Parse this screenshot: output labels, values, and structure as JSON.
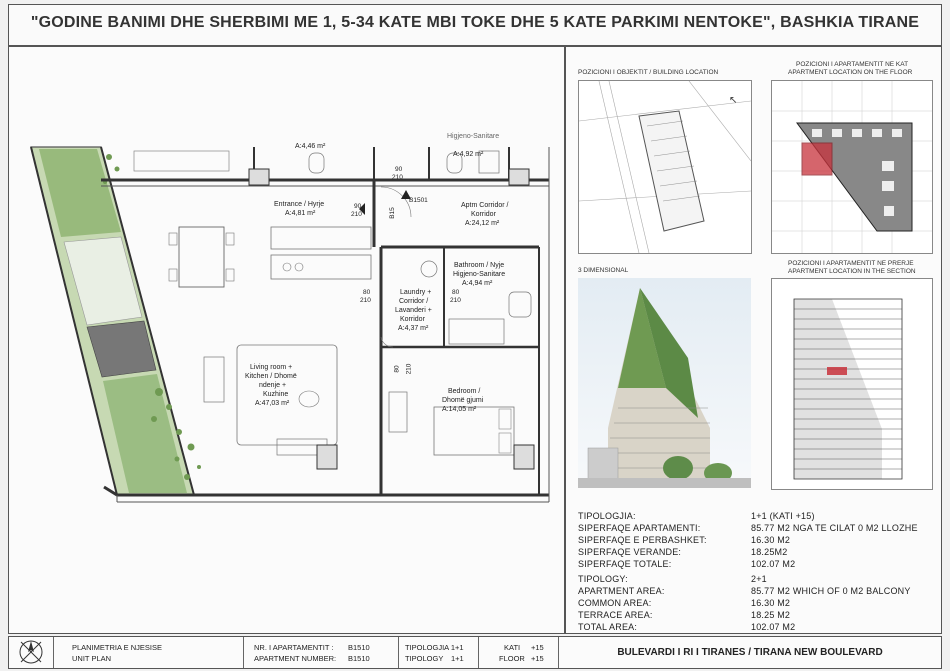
{
  "title": "\"GODINE BANIMI DHE SHERBIMI ME 1, 5-34 KATE MBI TOKE DHE 5 KATE PARKIMI NENTOKE\", BASHKIA TIRANE",
  "captions": {
    "building_location": "POZICIONI I OBJEKTIT / BUILDING LOCATION",
    "apt_floor_1": "POZICIONI I APARTAMENTIT NE KAT",
    "apt_floor_2": "APARTMENT LOCATION ON THE FLOOR",
    "three_d": "3 DIMENSIONAL",
    "apt_section_1": "POZICIONI I APARTAMENTIT NE PRERJE",
    "apt_section_2": "APARTMENT LOCATION IN THE SECTION"
  },
  "rooms": {
    "top_area": "A:4,46 m²",
    "hygiene_top": "Higjeno-Sanitare",
    "hygiene_top_area": "A:4,92 m²",
    "entrance": "Entrance / Hyrje",
    "entrance_area": "A:4,81 m²",
    "corridor_1": "Aptm Corridor /",
    "corridor_2": "Korridor",
    "corridor_area": "A:24,12 m²",
    "bath_1": "Bathroom / Nyje",
    "bath_2": "Higjeno-Sanitare",
    "bath_area": "A:4,94 m²",
    "laundry_1": "Laundry +",
    "laundry_2": "Corridor /",
    "laundry_3": "Lavanderi +",
    "laundry_4": "Korridor",
    "laundry_area": "A:4,37 m²",
    "living_1": "Living room +",
    "living_2": "Kitchen / Dhomë",
    "living_3": "ndenje +",
    "living_4": "Kuzhine",
    "living_area": "A:47,03 m²",
    "bed_1": "Bedroom /",
    "bed_2": "Dhomë gjumi",
    "bed_area": "A:14,05 m²"
  },
  "dims": {
    "d90": "90",
    "d210": "210",
    "d80": "80",
    "tag": "B1501",
    "tag_v": "B15"
  },
  "spec_al": [
    {
      "label": "TIPOLOGJIA:",
      "value": "1+1 (KATI +15)"
    },
    {
      "label": "SIPERFAQE APARTAMENTI:",
      "value": "85.77 M2 NGA TE CILAT 0 M2 LLOZHE"
    },
    {
      "label": "SIPERFAQE  E  PERBASHKET:",
      "value": "16.30 M2"
    },
    {
      "label": "SIPERFAQE  VERANDE:",
      "value": "18.25M2"
    },
    {
      "label": "SIPERFAQE  TOTALE:",
      "value": "102.07 M2"
    }
  ],
  "spec_en": [
    {
      "label": "TIPOLOGY:",
      "value": "2+1"
    },
    {
      "label": "APARTMENT AREA:",
      "value": "85.77 M2 WHICH OF 0 M2 BALCONY"
    },
    {
      "label": "COMMON AREA:",
      "value": "16.30 M2"
    },
    {
      "label": "TERRACE AREA:",
      "value": "18.25 M2"
    },
    {
      "label": "TOTAL AREA:",
      "value": "102.07 M2"
    }
  ],
  "footer": {
    "unit_plan_al": "PLANIMETRIA E NJESISE",
    "unit_plan_en": "UNIT PLAN",
    "apt_no_al": "NR. I APARTAMENTIT :",
    "apt_no_al_val": "B1510",
    "apt_no_en": "APARTMENT NUMBER:",
    "apt_no_en_val": "B1510",
    "tipologjia": "TIPOLOGJIA 1+1",
    "tipology": "TIPOLOGY",
    "tipology_val": "1+1",
    "kati": "KATI",
    "kati_val": "+15",
    "floor": "FLOOR",
    "floor_val": "+15",
    "boulevard": "BULEVARDI I RI I TIRANES / TIRANA NEW BOULEVARD"
  },
  "colors": {
    "highlight": "#c8323c",
    "greenery": "#6f9a52",
    "terrace": "#b8cfa0"
  }
}
